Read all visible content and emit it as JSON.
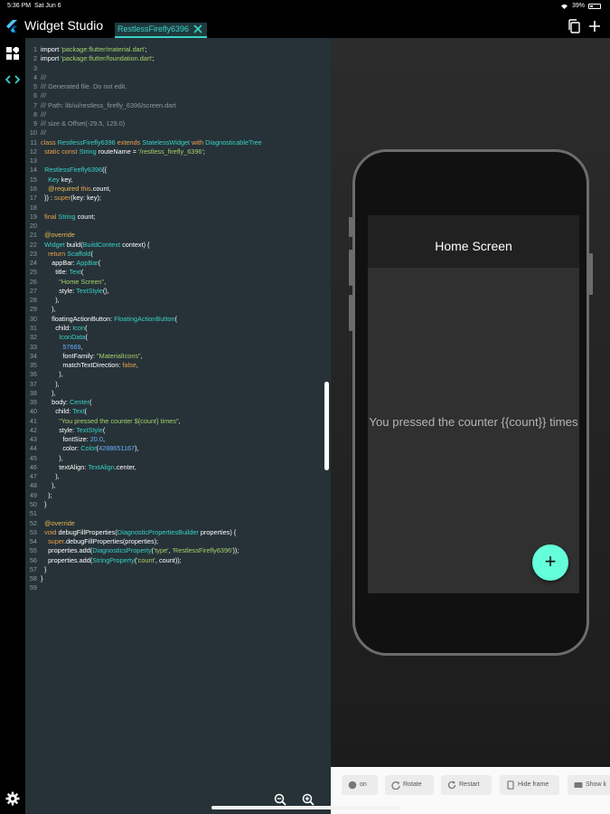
{
  "status_bar": {
    "time": "5:36 PM",
    "date": "Sat Jun 6",
    "battery": "39%"
  },
  "app": {
    "title": "Widget Studio",
    "tab": "RestlessFirefly6396"
  },
  "icons": {
    "logo": "flutter-logo-icon",
    "tab_close": "close-icon",
    "copy": "copy-icon",
    "add": "plus-icon",
    "widgets": "widgets-icon",
    "code": "code-icon",
    "settings": "gear-icon",
    "zoom_out": "zoom-out-icon",
    "zoom_in": "zoom-in-icon"
  },
  "colors": {
    "accent": "#3ad1c6",
    "editor_bg": "#263238",
    "fab": "#64ffda",
    "appbar": "#212121",
    "scaffold": "#303030"
  },
  "code": [
    [
      [
        "d",
        "import "
      ],
      [
        "s",
        "'package:flutter/material.dart'"
      ],
      [
        "d",
        ";"
      ]
    ],
    [
      [
        "d",
        "import "
      ],
      [
        "s",
        "'package:flutter/foundation.dart'"
      ],
      [
        "d",
        ";"
      ]
    ],
    [],
    [
      [
        "c",
        "///"
      ]
    ],
    [
      [
        "c",
        "/// Generated file. Do not edit."
      ]
    ],
    [
      [
        "c",
        "///"
      ]
    ],
    [
      [
        "c",
        "/// Path: lib/ui/restless_firefly_6396/screen.dart"
      ]
    ],
    [
      [
        "c",
        "///"
      ]
    ],
    [
      [
        "c",
        "/// size & Offset(-29.5, 129.0)"
      ]
    ],
    [
      [
        "c",
        "///"
      ]
    ],
    [
      [
        "k",
        "class "
      ],
      [
        "ty",
        "RestlessFirefly6396 "
      ],
      [
        "k",
        "extends "
      ],
      [
        "ty",
        "StatelessWidget "
      ],
      [
        "k",
        "with "
      ],
      [
        "ty",
        "DiagnosticableTree"
      ]
    ],
    [
      [
        "d",
        "  "
      ],
      [
        "k",
        "static const "
      ],
      [
        "ty",
        "String "
      ],
      [
        "d",
        "routeName = "
      ],
      [
        "s",
        "'/restless_firefly_6396'"
      ],
      [
        "d",
        ";"
      ]
    ],
    [],
    [
      [
        "d",
        "  "
      ],
      [
        "ty",
        "RestlessFirefly6396"
      ],
      [
        "d",
        "({"
      ]
    ],
    [
      [
        "d",
        "    "
      ],
      [
        "ty",
        "Key "
      ],
      [
        "d",
        "key,"
      ]
    ],
    [
      [
        "d",
        "    "
      ],
      [
        "a",
        "@required "
      ],
      [
        "k",
        "this"
      ],
      [
        "d",
        ".count,"
      ]
    ],
    [
      [
        "d",
        "  }) : "
      ],
      [
        "k",
        "super"
      ],
      [
        "d",
        "(key: key);"
      ]
    ],
    [],
    [
      [
        "d",
        "  "
      ],
      [
        "k",
        "final "
      ],
      [
        "ty",
        "String "
      ],
      [
        "d",
        "count;"
      ]
    ],
    [],
    [
      [
        "d",
        "  "
      ],
      [
        "a",
        "@override"
      ]
    ],
    [
      [
        "d",
        "  "
      ],
      [
        "ty",
        "Widget "
      ],
      [
        "d",
        "build("
      ],
      [
        "ty",
        "BuildContext "
      ],
      [
        "d",
        "context) {"
      ]
    ],
    [
      [
        "d",
        "    "
      ],
      [
        "k",
        "return "
      ],
      [
        "ty",
        "Scaffold"
      ],
      [
        "d",
        "("
      ]
    ],
    [
      [
        "d",
        "      appBar: "
      ],
      [
        "ty",
        "AppBar"
      ],
      [
        "d",
        "("
      ]
    ],
    [
      [
        "d",
        "        title: "
      ],
      [
        "ty",
        "Text"
      ],
      [
        "d",
        "("
      ]
    ],
    [
      [
        "d",
        "          "
      ],
      [
        "s",
        "\"Home Screen\""
      ],
      [
        "d",
        ","
      ]
    ],
    [
      [
        "d",
        "          style: "
      ],
      [
        "ty",
        "TextStyle"
      ],
      [
        "d",
        "(),"
      ]
    ],
    [
      [
        "d",
        "        ),"
      ]
    ],
    [
      [
        "d",
        "      ),"
      ]
    ],
    [
      [
        "d",
        "      floatingActionButton: "
      ],
      [
        "ty",
        "FloatingActionButton"
      ],
      [
        "d",
        "("
      ]
    ],
    [
      [
        "d",
        "        child: "
      ],
      [
        "ty",
        "Icon"
      ],
      [
        "d",
        "("
      ]
    ],
    [
      [
        "d",
        "          "
      ],
      [
        "ty",
        "IconData"
      ],
      [
        "d",
        "("
      ]
    ],
    [
      [
        "d",
        "            "
      ],
      [
        "n",
        "57669"
      ],
      [
        "d",
        ","
      ]
    ],
    [
      [
        "d",
        "            fontFamily: "
      ],
      [
        "s",
        "\"MaterialIcons\""
      ],
      [
        "d",
        ","
      ]
    ],
    [
      [
        "d",
        "            matchTextDirection: "
      ],
      [
        "k",
        "false"
      ],
      [
        "d",
        ","
      ]
    ],
    [
      [
        "d",
        "          ),"
      ]
    ],
    [
      [
        "d",
        "        ),"
      ]
    ],
    [
      [
        "d",
        "      ),"
      ]
    ],
    [
      [
        "d",
        "      body: "
      ],
      [
        "ty",
        "Center"
      ],
      [
        "d",
        "("
      ]
    ],
    [
      [
        "d",
        "        child: "
      ],
      [
        "ty",
        "Text"
      ],
      [
        "d",
        "("
      ]
    ],
    [
      [
        "d",
        "          "
      ],
      [
        "s",
        "\"You pressed the counter ${count} times\""
      ],
      [
        "d",
        ","
      ]
    ],
    [
      [
        "d",
        "          style: "
      ],
      [
        "ty",
        "TextStyle"
      ],
      [
        "d",
        "("
      ]
    ],
    [
      [
        "d",
        "            fontSize: "
      ],
      [
        "n",
        "20.0"
      ],
      [
        "d",
        ","
      ]
    ],
    [
      [
        "d",
        "            color: "
      ],
      [
        "ty",
        "Color"
      ],
      [
        "d",
        "("
      ],
      [
        "n",
        "4288651167"
      ],
      [
        "d",
        "),"
      ]
    ],
    [
      [
        "d",
        "          ),"
      ]
    ],
    [
      [
        "d",
        "          textAlign: "
      ],
      [
        "ty",
        "TextAlign"
      ],
      [
        "d",
        ".center,"
      ]
    ],
    [
      [
        "d",
        "        ),"
      ]
    ],
    [
      [
        "d",
        "      ),"
      ]
    ],
    [
      [
        "d",
        "    );"
      ]
    ],
    [
      [
        "d",
        "  }"
      ]
    ],
    [],
    [
      [
        "d",
        "  "
      ],
      [
        "a",
        "@override"
      ]
    ],
    [
      [
        "d",
        "  "
      ],
      [
        "k",
        "void "
      ],
      [
        "d",
        "debugFillProperties("
      ],
      [
        "ty",
        "DiagnosticPropertiesBuilder "
      ],
      [
        "d",
        "properties) {"
      ]
    ],
    [
      [
        "d",
        "    "
      ],
      [
        "k",
        "super"
      ],
      [
        "d",
        ".debugFillProperties(properties);"
      ]
    ],
    [
      [
        "d",
        "    properties.add("
      ],
      [
        "ty",
        "DiagnosticsProperty"
      ],
      [
        "d",
        "("
      ],
      [
        "s",
        "'type'"
      ],
      [
        "d",
        ", "
      ],
      [
        "s",
        "'RestlessFirefly6396'"
      ],
      [
        "d",
        "));"
      ]
    ],
    [
      [
        "d",
        "    properties.add("
      ],
      [
        "ty",
        "StringProperty"
      ],
      [
        "d",
        "("
      ],
      [
        "s",
        "'count'"
      ],
      [
        "d",
        ", count));"
      ]
    ],
    [
      [
        "d",
        "  }"
      ]
    ],
    [
      [
        "d",
        "}"
      ]
    ],
    []
  ],
  "preview": {
    "screen_title": "Home Screen",
    "body_text": "You pressed the counter {{count}} times",
    "fab_label": "+"
  },
  "toolbar": {
    "buttons": [
      {
        "name": "toggle-button",
        "label": "on",
        "icon": "globe-icon"
      },
      {
        "name": "rotate-button",
        "label": "Rotate",
        "icon": "rotate-icon"
      },
      {
        "name": "restart-button",
        "label": "Restart",
        "icon": "refresh-icon"
      },
      {
        "name": "hide-frame-button",
        "label": "Hide frame",
        "icon": "frame-icon"
      },
      {
        "name": "show-keyboard-button",
        "label": "Show k",
        "icon": "keyboard-icon"
      }
    ]
  }
}
